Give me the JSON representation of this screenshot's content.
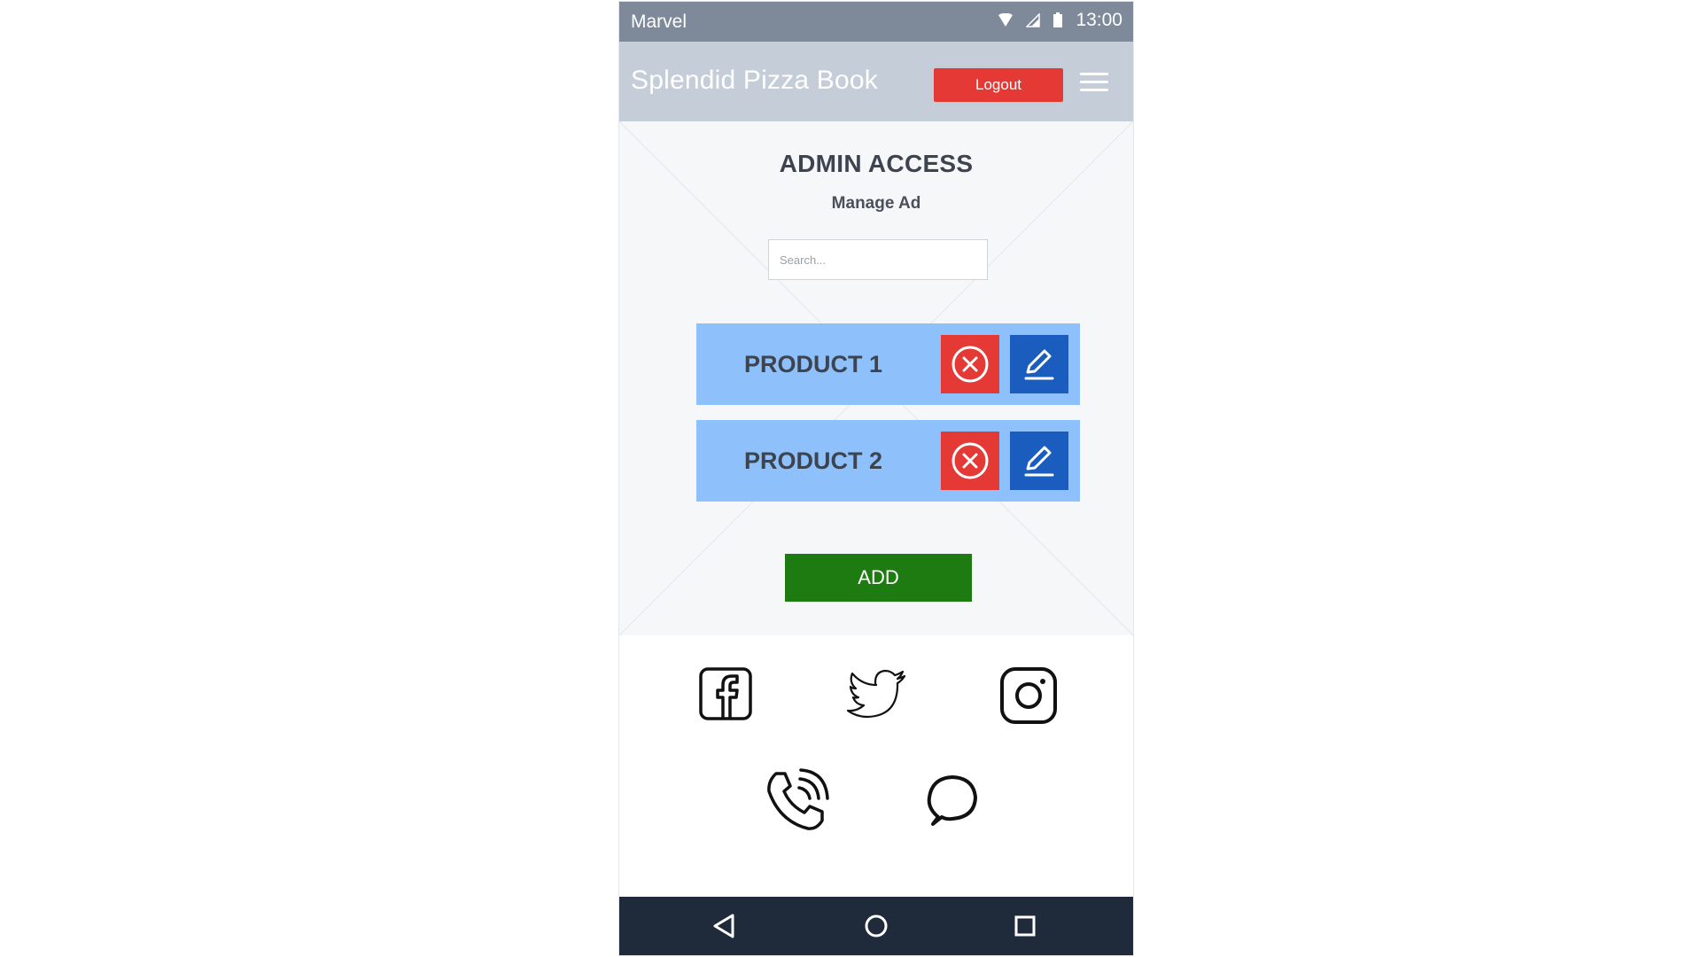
{
  "status_bar": {
    "carrier": "Marvel",
    "time": "13:00"
  },
  "header": {
    "app_title": "Splendid Pizza Book",
    "logout_label": "Logout"
  },
  "main": {
    "title": "ADMIN ACCESS",
    "subtitle": "Manage Ad",
    "search_placeholder": "Search...",
    "products": [
      {
        "name": "PRODUCT 1"
      },
      {
        "name": "PRODUCT 2"
      }
    ],
    "add_label": "ADD"
  },
  "colors": {
    "status_bar": "#7e8a99",
    "header": "#c4cdd8",
    "logout": "#e53935",
    "product_row": "#8ec0fb",
    "delete": "#e53935",
    "edit": "#1b5dbf",
    "add": "#1e7b12",
    "nav_bar": "#1f2b3a"
  },
  "social_icons": [
    "facebook-icon",
    "twitter-icon",
    "instagram-icon",
    "phone-icon",
    "chat-icon"
  ],
  "nav_icons": [
    "back-icon",
    "home-icon",
    "recents-icon"
  ]
}
